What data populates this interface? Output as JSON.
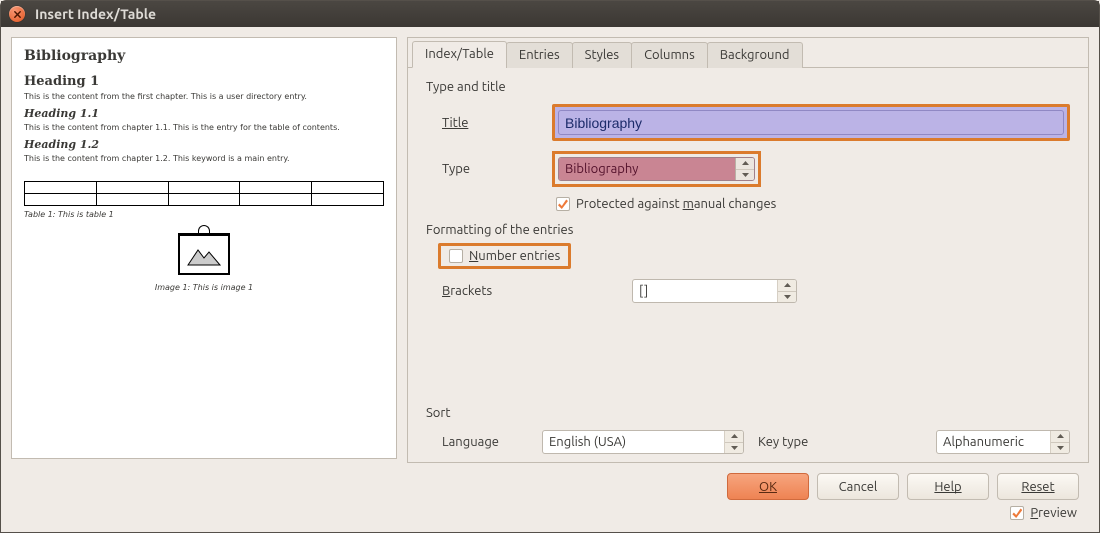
{
  "window_title": "Insert Index/Table",
  "preview": {
    "bib": "Bibliography",
    "h1": "Heading 1",
    "b1": "This is the content from the first chapter. This is a user directory entry.",
    "h11": "Heading 1.1",
    "b11": "This is the content from chapter 1.1. This is the entry for the table of contents.",
    "h12": "Heading 1.2",
    "b12": "This is the content from chapter 1.2. This keyword is a main entry.",
    "table_caption": "Table 1: This is table 1",
    "image_caption": "Image 1: This is image 1"
  },
  "tabs": [
    "Index/Table",
    "Entries",
    "Styles",
    "Columns",
    "Background"
  ],
  "type_title": {
    "section": "Type and title",
    "title_label": "Title",
    "title_value": "Bibliography",
    "type_label": "Type",
    "type_value": "Bibliography",
    "protect_label": "Protected against manual changes"
  },
  "formatting": {
    "section": "Formatting of the entries",
    "number_entries": "Number entries",
    "brackets_label": "Brackets",
    "brackets_value": "[]"
  },
  "sort": {
    "section": "Sort",
    "language_label": "Language",
    "language_value": "English (USA)",
    "keytype_label": "Key type",
    "keytype_value": "Alphanumeric"
  },
  "buttons": {
    "ok": "OK",
    "cancel": "Cancel",
    "help": "Help",
    "reset": "Reset"
  },
  "preview_label": "Preview"
}
